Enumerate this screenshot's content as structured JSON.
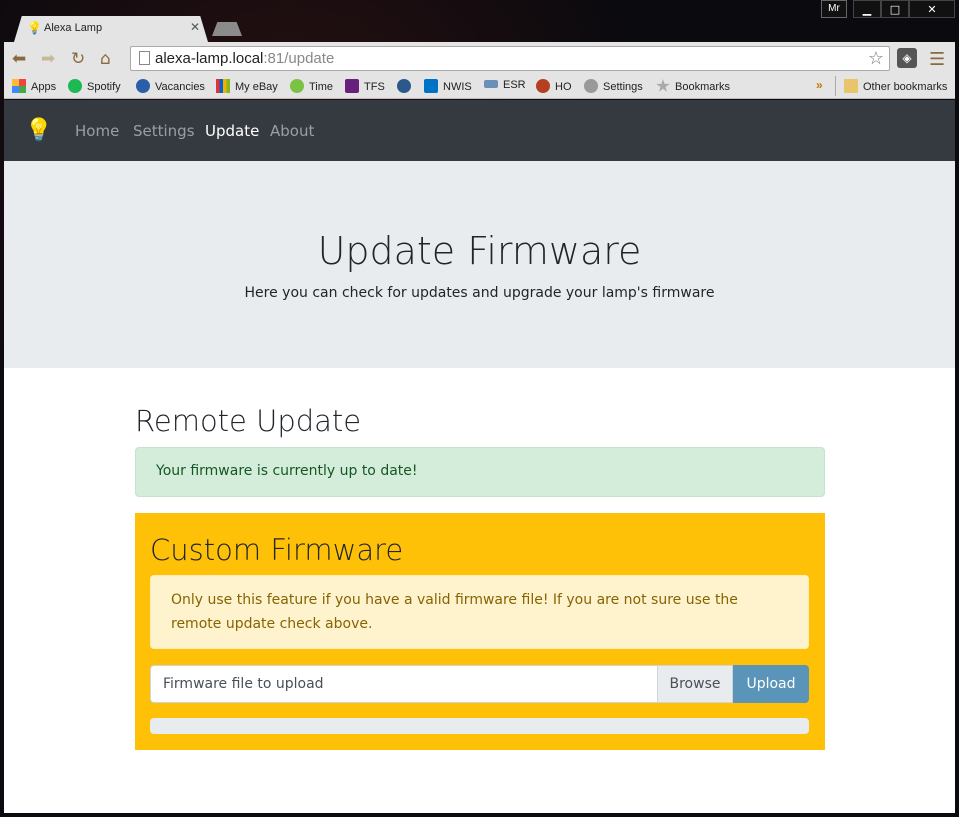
{
  "browser": {
    "tab_title": "Alexa Lamp",
    "user_badge": "Mr",
    "url_host": "alexa-lamp.local",
    "url_rest": ":81/update",
    "bookmarks": [
      "Apps",
      "Spotify",
      "Vacancies",
      "My eBay",
      "Time",
      "TFS",
      "NWIS",
      "ESR",
      "HO",
      "Settings",
      "Bookmarks"
    ],
    "other_bookmarks": "Other bookmarks",
    "bookmark_overflow": "»"
  },
  "nav": {
    "links": [
      "Home",
      "Settings",
      "Update",
      "About"
    ],
    "active": "Update"
  },
  "jumbotron": {
    "title": "Update Firmware",
    "subtitle": "Here you can check for updates and upgrade your lamp's firmware"
  },
  "remote": {
    "heading": "Remote Update",
    "status": "Your firmware is currently up to date!"
  },
  "custom": {
    "heading": "Custom Firmware",
    "warning": "Only use this feature if you have a valid firmware file! If you are not sure use the remote update check above.",
    "file_placeholder": "Firmware file to upload",
    "browse_label": "Browse",
    "upload_label": "Upload",
    "progress": 0
  },
  "colors": {
    "navbar": "#343a40",
    "jumbotron": "#e9ecef",
    "success_bg": "#d4edda",
    "warning_panel": "#ffc107",
    "warning_alert_bg": "#fff3cd",
    "upload_button": "#5a94b8"
  }
}
